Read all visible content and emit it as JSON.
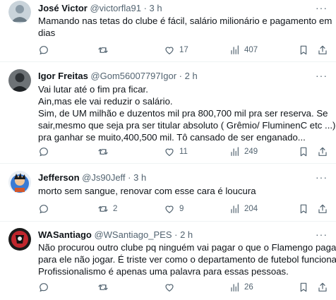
{
  "tweets": [
    {
      "name": "José Victor",
      "handle": "@victorfla91",
      "dot": "·",
      "time": "3 h",
      "more": "···",
      "lines": [
        "Mamando nas tetas do clube é fácil, salário milionário e pagamento em",
        "dias"
      ],
      "replies": "",
      "retweets": "",
      "likes": "17",
      "views": "407",
      "avatar_color": "#8a9aa6"
    },
    {
      "name": "Igor Freitas",
      "handle": "@Gom56007797Igor",
      "dot": "·",
      "time": "2 h",
      "more": "···",
      "lines": [
        "Vai lutar até o fim pra ficar.",
        "Ain,mas ele vai reduzir o salário.",
        "Sim, de UM milhão e duzentos mil pra 800,700 mil pra ser reserva. Se",
        "sair,mesmo que seja pra ser titular absoluto ( Grêmio/ FluminenC etc ...) é",
        "pra ganhar se muito,400,500 mil. Tô cansado de ser enganado..."
      ],
      "replies": "",
      "retweets": "",
      "likes": "11",
      "views": "249",
      "avatar_color": "#4a4f55"
    },
    {
      "name": "Jefferson",
      "handle": "@Js90Jeff",
      "dot": "·",
      "time": "3 h",
      "more": "···",
      "lines": [
        "morto sem sangue, renovar com esse cara é loucura"
      ],
      "replies": "",
      "retweets": "2",
      "likes": "9",
      "views": "204",
      "avatar_color": "#3a7bd5"
    },
    {
      "name": "WASantiago",
      "handle": "@WSantiago_PES",
      "dot": "·",
      "time": "2 h",
      "more": "···",
      "lines": [
        "Não procurou outro clube pq ninguém vai pagar o que o Flamengo paga",
        "para ele não jogar. É triste ver como o departamento de futebol funciona.",
        "Profissionalismo é apenas uma palavra para essas pessoas."
      ],
      "replies": "",
      "retweets": "",
      "likes": "",
      "views": "26",
      "avatar_color": "#c0262d"
    }
  ],
  "colors": {
    "icon": "#536471",
    "text": "#0f1419",
    "divider": "#eff3f4"
  }
}
